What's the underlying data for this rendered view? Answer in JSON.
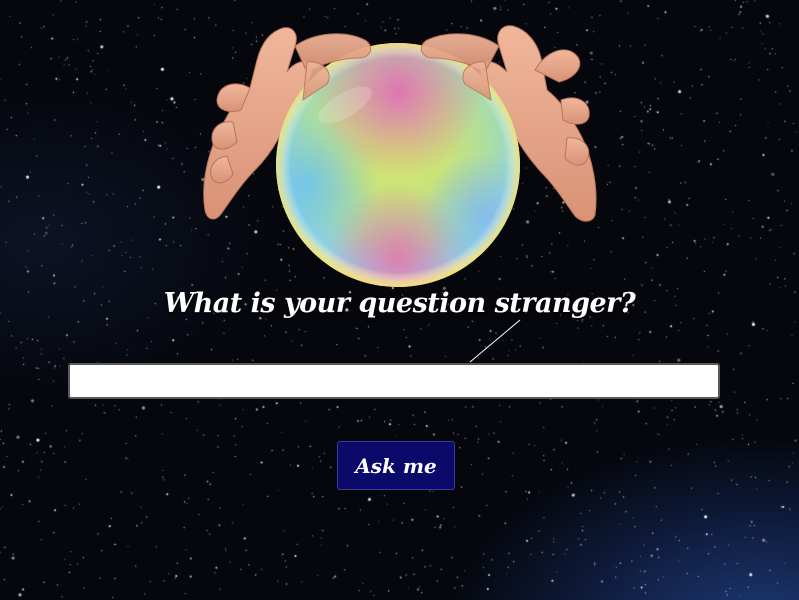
{
  "page": {
    "title": "What is your question stranger?"
  },
  "question_input": {
    "value": "",
    "placeholder": ""
  },
  "ask_button": {
    "label": "Ask me"
  },
  "illustration": {
    "icon": "crystal-ball-with-hands-icon"
  },
  "colors": {
    "background": "#05070d",
    "nebula": "#1e3a78",
    "button": "#0b0a6b",
    "title_text": "#ffffff",
    "skin": "#e9a98a"
  }
}
